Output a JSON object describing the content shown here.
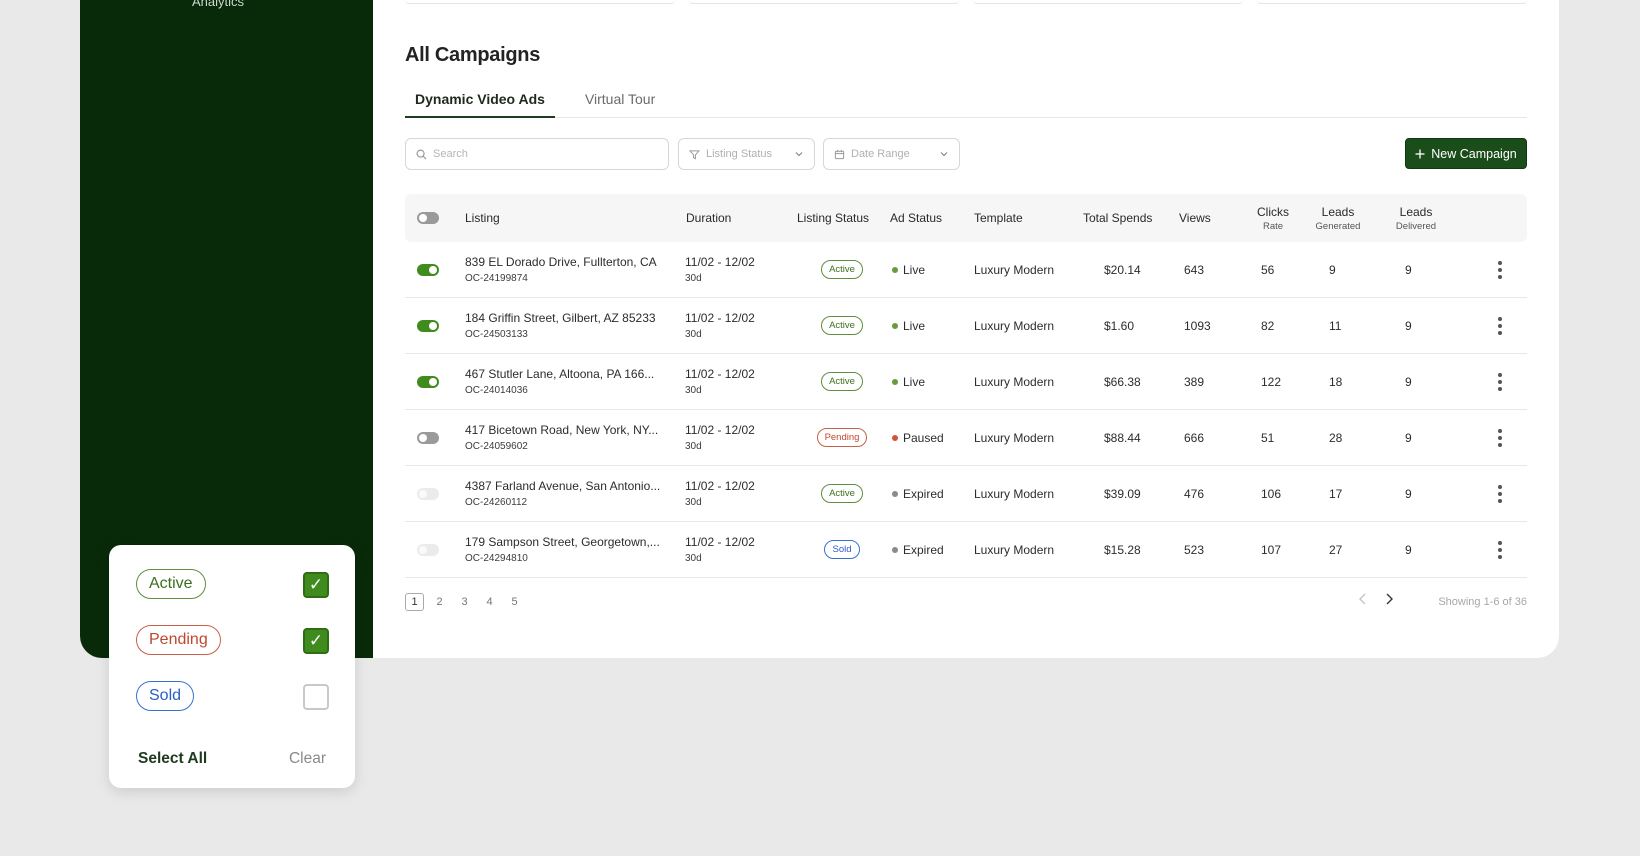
{
  "sidebar": {
    "cutoff_label": "Analytics"
  },
  "page": {
    "title": "All Campaigns"
  },
  "tabs": [
    {
      "label": "Dynamic Video Ads",
      "active": true
    },
    {
      "label": "Virtual Tour",
      "active": false
    }
  ],
  "filters": {
    "search_placeholder": "Search",
    "listing_status_placeholder": "Listing Status",
    "date_range_placeholder": "Date Range",
    "new_campaign_label": "New Campaign"
  },
  "table": {
    "headers": {
      "listing": "Listing",
      "duration": "Duration",
      "listing_status": "Listing Status",
      "ad_status": "Ad Status",
      "template": "Template",
      "total_spends": "Total Spends",
      "views": "Views",
      "clicks_title": "Clicks",
      "clicks_sub": "Rate",
      "leads_gen_title": "Leads",
      "leads_gen_sub": "Generated",
      "leads_del_title": "Leads",
      "leads_del_sub": "Delivered"
    },
    "rows": [
      {
        "toggle": "on",
        "address": "839 EL Dorado Drive, Fullterton, CA",
        "id": "OC-24199874",
        "dates": "11/02 - 12/02",
        "days": "30d",
        "status": "Active",
        "status_kind": "active",
        "ad_status": "Live",
        "ad_color": "#6a9a3c",
        "template": "Luxury Modern",
        "spend": "$20.14",
        "views": "643",
        "clicks": "56",
        "leads_gen": "9",
        "leads_del": "9"
      },
      {
        "toggle": "on",
        "address": "184 Griffin Street, Gilbert, AZ 85233",
        "id": "OC-24503133",
        "dates": "11/02 - 12/02",
        "days": "30d",
        "status": "Active",
        "status_kind": "active",
        "ad_status": "Live",
        "ad_color": "#6a9a3c",
        "template": "Luxury Modern",
        "spend": "$1.60",
        "views": "1093",
        "clicks": "82",
        "leads_gen": "11",
        "leads_del": "9"
      },
      {
        "toggle": "on",
        "address": "467 Stutler Lane, Altoona, PA 166...",
        "id": "OC-24014036",
        "dates": "11/02 - 12/02",
        "days": "30d",
        "status": "Active",
        "status_kind": "active",
        "ad_status": "Live",
        "ad_color": "#6a9a3c",
        "template": "Luxury Modern",
        "spend": "$66.38",
        "views": "389",
        "clicks": "122",
        "leads_gen": "18",
        "leads_del": "9"
      },
      {
        "toggle": "off",
        "address": "417 Bicetown Road, New York, NY...",
        "id": "OC-24059602",
        "dates": "11/02 - 12/02",
        "days": "30d",
        "status": "Pending",
        "status_kind": "pending",
        "ad_status": "Paused",
        "ad_color": "#d0533a",
        "template": "Luxury Modern",
        "spend": "$88.44",
        "views": "666",
        "clicks": "51",
        "leads_gen": "28",
        "leads_del": "9"
      },
      {
        "toggle": "disabled",
        "address": "4387 Farland Avenue, San Antonio...",
        "id": "OC-24260112",
        "dates": "11/02 - 12/02",
        "days": "30d",
        "status": "Active",
        "status_kind": "active",
        "ad_status": "Expired",
        "ad_color": "#8a8a8a",
        "template": "Luxury Modern",
        "spend": "$39.09",
        "views": "476",
        "clicks": "106",
        "leads_gen": "17",
        "leads_del": "9"
      },
      {
        "toggle": "disabled",
        "address": "179 Sampson Street, Georgetown,...",
        "id": "OC-24294810",
        "dates": "11/02 - 12/02",
        "days": "30d",
        "status": "Sold",
        "status_kind": "sold",
        "ad_status": "Expired",
        "ad_color": "#8a8a8a",
        "template": "Luxury Modern",
        "spend": "$15.28",
        "views": "523",
        "clicks": "107",
        "leads_gen": "27",
        "leads_del": "9"
      }
    ]
  },
  "pagination": {
    "pages": [
      "1",
      "2",
      "3",
      "4",
      "5"
    ],
    "current": "1",
    "showing": "Showing 1-6 of 36"
  },
  "status_filter_popup": {
    "options": [
      {
        "label": "Active",
        "kind": "active",
        "checked": true
      },
      {
        "label": "Pending",
        "kind": "pending",
        "checked": true
      },
      {
        "label": "Sold",
        "kind": "sold",
        "checked": false
      }
    ],
    "select_all": "Select All",
    "clear": "Clear",
    "check_glyph": "✓"
  },
  "colors": {
    "sidebar_bg": "#082a09",
    "primary_button": "#1b4d1b",
    "toggle_on": "#3f8b1e"
  }
}
